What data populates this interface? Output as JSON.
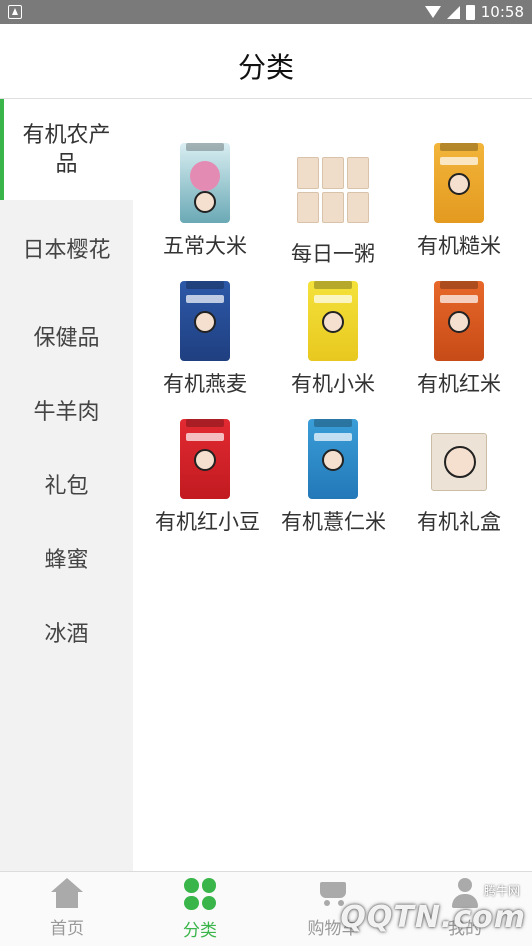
{
  "status_bar": {
    "time": "10:58"
  },
  "header": {
    "title": "分类"
  },
  "sidebar": {
    "items": [
      {
        "label": "有机农产品",
        "active": true
      },
      {
        "label": "日本樱花",
        "active": false
      },
      {
        "label": "保健品",
        "active": false
      },
      {
        "label": "牛羊肉",
        "active": false
      },
      {
        "label": "礼包",
        "active": false
      },
      {
        "label": "蜂蜜",
        "active": false
      },
      {
        "label": "冰酒",
        "active": false
      }
    ]
  },
  "products": [
    {
      "name": "五常大米"
    },
    {
      "name": "每日一粥"
    },
    {
      "name": "有机糙米"
    },
    {
      "name": "有机燕麦"
    },
    {
      "name": "有机小米"
    },
    {
      "name": "有机红米"
    },
    {
      "name": "有机红小豆"
    },
    {
      "name": "有机薏仁米"
    },
    {
      "name": "有机礼盒"
    }
  ],
  "tabbar": {
    "tabs": [
      {
        "label": "首页",
        "icon": "home-icon",
        "active": false
      },
      {
        "label": "分类",
        "icon": "category-grid-icon",
        "active": true
      },
      {
        "label": "购物车",
        "icon": "cart-icon",
        "active": false
      },
      {
        "label": "我的",
        "icon": "user-icon",
        "active": false
      }
    ]
  },
  "watermark": {
    "brand": "QQTN.com",
    "cn": "腾牛网"
  },
  "colors": {
    "accent": "#3ab54a",
    "sidebar_bg": "#f2f2f2",
    "status_bar": "#7a7a7a"
  }
}
